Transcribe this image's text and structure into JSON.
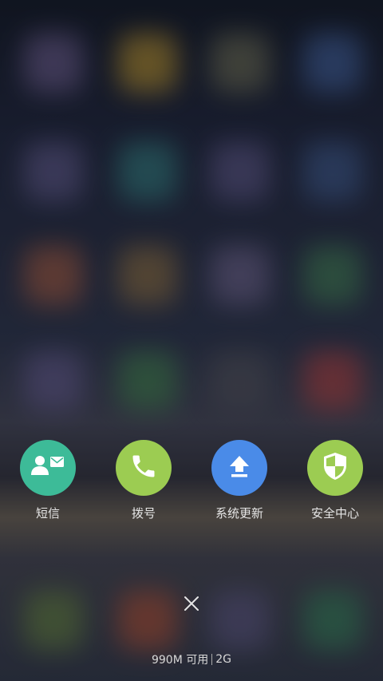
{
  "colors": {
    "sms": "#3dbb98",
    "dial": "#9ccc52",
    "update": "#4a8be8",
    "security": "#9ccc52"
  },
  "shortcuts": [
    {
      "label": "短信",
      "icon": "contact-message-icon"
    },
    {
      "label": "拨号",
      "icon": "phone-icon"
    },
    {
      "label": "系统更新",
      "icon": "upload-icon"
    },
    {
      "label": "安全中心",
      "icon": "shield-icon"
    }
  ],
  "close": {
    "icon": "close-icon"
  },
  "memory": {
    "available": "990M 可用",
    "total": "2G"
  }
}
